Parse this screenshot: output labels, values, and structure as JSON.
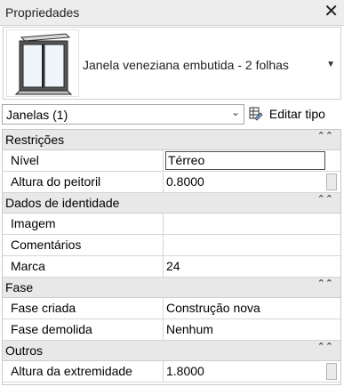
{
  "panel": {
    "title": "Propriedades",
    "close_label": "✕"
  },
  "type_selector": {
    "name": "Janela veneziana embutida - 2 folhas",
    "arrow": "▼"
  },
  "instance": {
    "selected": "Janelas (1)",
    "chevron": "⌄",
    "edit_type_label": "Editar tipo"
  },
  "groups": [
    {
      "name": "Restrições",
      "collapse": "⌃⌃",
      "rows": [
        {
          "name": "Nível",
          "value": "Térreo"
        },
        {
          "name": "Altura do peitoril",
          "value": "0.8000"
        }
      ]
    },
    {
      "name": "Dados de identidade",
      "collapse": "⌃⌃",
      "rows": [
        {
          "name": "Imagem",
          "value": ""
        },
        {
          "name": "Comentários",
          "value": ""
        },
        {
          "name": "Marca",
          "value": "24"
        }
      ]
    },
    {
      "name": "Fase",
      "collapse": "⌃⌃",
      "rows": [
        {
          "name": "Fase criada",
          "value": "Construção nova"
        },
        {
          "name": "Fase demolida",
          "value": "Nenhum"
        }
      ]
    },
    {
      "name": "Outros",
      "collapse": "⌃⌃",
      "rows": [
        {
          "name": "Altura da extremidade",
          "value": "1.8000"
        }
      ]
    }
  ],
  "icons": {
    "close": "close-icon",
    "window_thumbnail": "window-thumbnail-icon",
    "edit_type": "edit-type-icon",
    "dropdown": "chevron-down-icon",
    "collapse": "collapse-group-icon"
  }
}
